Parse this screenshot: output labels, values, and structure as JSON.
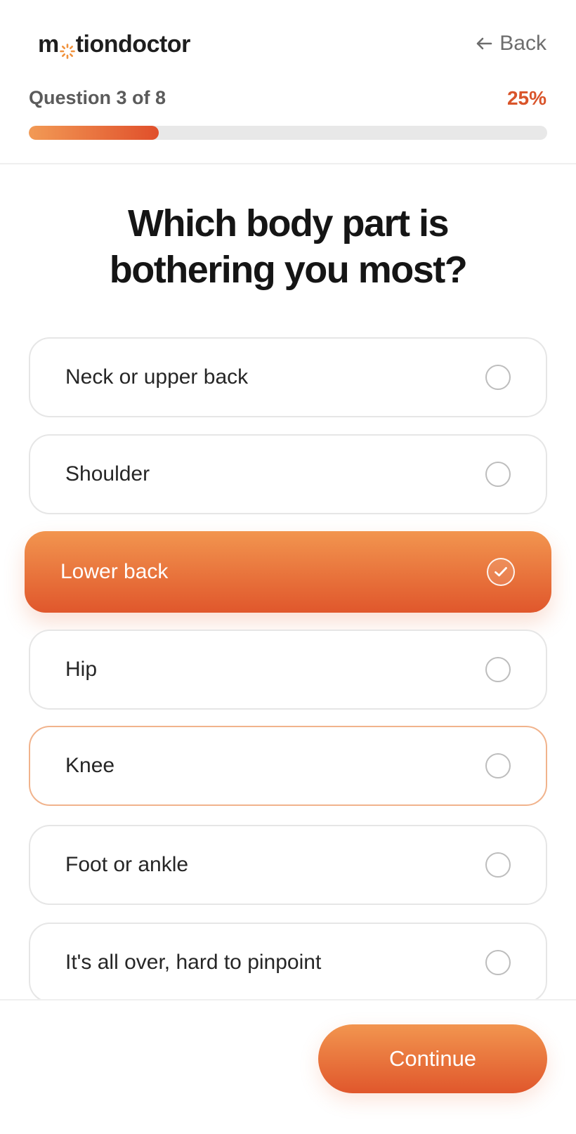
{
  "header": {
    "logo": {
      "pre": "m",
      "post": "tiondoctor"
    },
    "back_label": "Back"
  },
  "progress": {
    "label": "Question 3 of 8",
    "percent_label": "25%",
    "fraction": 0.25
  },
  "question": {
    "title": "Which body part is bothering you most?"
  },
  "options": [
    {
      "label": "Neck or upper back",
      "selected": false
    },
    {
      "label": "Shoulder",
      "selected": false
    },
    {
      "label": "Lower back",
      "selected": true
    },
    {
      "label": "Hip",
      "selected": false
    },
    {
      "label": "Knee",
      "selected": false
    },
    {
      "label": "Foot or ankle",
      "selected": false
    },
    {
      "label": "It's all over, hard to pinpoint",
      "selected": false
    }
  ],
  "footer": {
    "continue_label": "Continue"
  },
  "colors": {
    "accent": "#e8672f",
    "accent_light": "#f2954f",
    "percent_text": "#d9542a",
    "muted_text": "#6d6d6d"
  },
  "icons": {
    "back": "arrow-left-icon",
    "selected_check": "check-circle-icon",
    "radio": "radio-empty-icon",
    "logo_mark": "sun-ring-icon"
  }
}
